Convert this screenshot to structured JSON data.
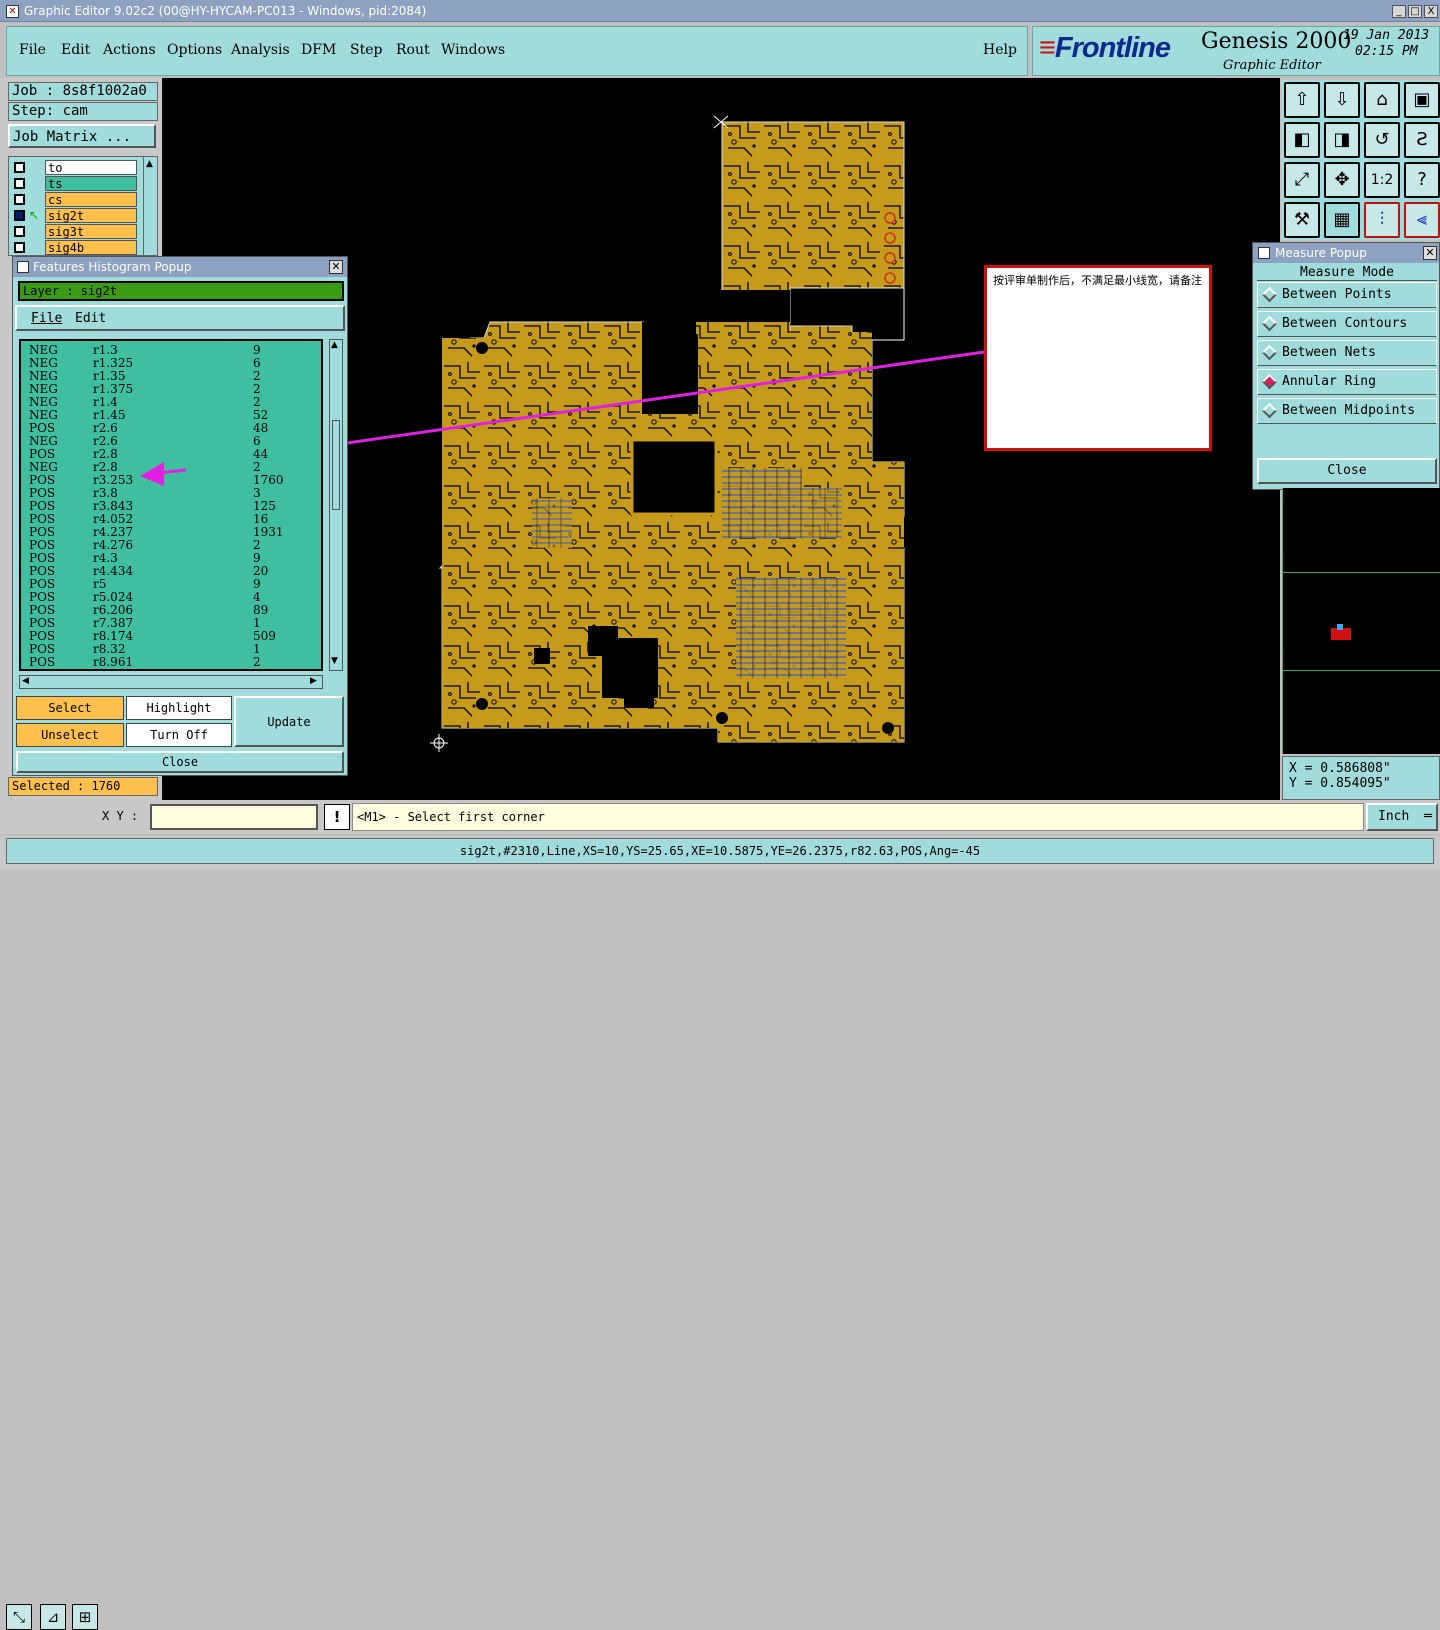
{
  "window": {
    "title": "Graphic Editor 9.02c2 (00@HY-HYCAM-PC013 - Windows, pid:2084)",
    "buttons": [
      "_",
      "□",
      "X"
    ]
  },
  "menubar": {
    "items": [
      "File",
      "Edit",
      "Actions",
      "Options",
      "Analysis",
      "DFM",
      "Step",
      "Rout",
      "Windows"
    ],
    "help": "Help"
  },
  "brand": {
    "logo": "Frontline",
    "product": "Genesis 2000",
    "subtitle": "Graphic Editor",
    "date": "19 Jan 2013",
    "time": "02:15 PM"
  },
  "job": {
    "job_label": "Job : 8s8f1002a0",
    "step_label": "Step: cam",
    "matrix_button": "Job Matrix ..."
  },
  "layers": [
    {
      "name": "to",
      "color": "#ffffff"
    },
    {
      "name": "ts",
      "color": "#3fbf9f"
    },
    {
      "name": "cs",
      "color": "#ffc04d"
    },
    {
      "name": "sig2t",
      "color": "#ffc04d"
    },
    {
      "name": "sig3t",
      "color": "#ffc04d"
    },
    {
      "name": "sig4b",
      "color": "#ffc04d"
    }
  ],
  "histogram_popup": {
    "title": "Features Histogram Popup",
    "layer_label": "Layer :  sig2t",
    "menu_file": "File",
    "menu_edit": "Edit",
    "rows": [
      [
        "NEG",
        "r1.3",
        "9"
      ],
      [
        "NEG",
        "r1.325",
        "6"
      ],
      [
        "NEG",
        "r1.35",
        "2"
      ],
      [
        "NEG",
        "r1.375",
        "2"
      ],
      [
        "NEG",
        "r1.4",
        "2"
      ],
      [
        "NEG",
        "r1.45",
        "52"
      ],
      [
        "POS",
        "r2.6",
        "48"
      ],
      [
        "NEG",
        "r2.6",
        "6"
      ],
      [
        "POS",
        "r2.8",
        "44"
      ],
      [
        "NEG",
        "r2.8",
        "2"
      ],
      [
        "POS",
        "r3.253",
        "1760"
      ],
      [
        "POS",
        "r3.8",
        "3"
      ],
      [
        "POS",
        "r3.843",
        "125"
      ],
      [
        "POS",
        "r4.052",
        "16"
      ],
      [
        "POS",
        "r4.237",
        "1931"
      ],
      [
        "POS",
        "r4.276",
        "2"
      ],
      [
        "POS",
        "r4.3",
        "9"
      ],
      [
        "POS",
        "r4.434",
        "20"
      ],
      [
        "POS",
        "r5",
        "9"
      ],
      [
        "POS",
        "r5.024",
        "4"
      ],
      [
        "POS",
        "r6.206",
        "89"
      ],
      [
        "POS",
        "r7.387",
        "1"
      ],
      [
        "POS",
        "r8.174",
        "509"
      ],
      [
        "POS",
        "r8.32",
        "1"
      ],
      [
        "POS",
        "r8.961",
        "2"
      ]
    ],
    "select": "Select",
    "highlight": "Highlight",
    "unselect": "Unselect",
    "turn_off": "Turn Off",
    "update": "Update",
    "close": "Close"
  },
  "selected_label": "Selected : 1760",
  "annotation": {
    "text": "按评审单制作后，不满足最小线宽，请备注"
  },
  "measure_popup": {
    "title": "Measure Popup",
    "mode_label": "Measure Mode",
    "options": [
      {
        "label": "Between Points",
        "selected": false
      },
      {
        "label": "Between Contours",
        "selected": false
      },
      {
        "label": "Between Nets",
        "selected": false
      },
      {
        "label": "Annular Ring",
        "selected": true
      },
      {
        "label": "Between Midpoints",
        "selected": false
      }
    ],
    "close": "Close"
  },
  "toolbox": {
    "icons": [
      "layer-up-icon",
      "layer-down-icon",
      "home-icon",
      "window-icon",
      "shift-left-icon",
      "shift-right-icon",
      "rotate-icon",
      "redraw-icon",
      "fit-icon",
      "zoom-in-icon",
      "one-to-one-icon",
      "help-icon",
      "tool-icon",
      "grid-icon",
      "snap-icon",
      "drc-icon"
    ],
    "one_to_one": "1:2",
    "help": "?"
  },
  "coords": {
    "x_label": "X = 0.586808\"",
    "y_label": "Y = 0.854095\""
  },
  "status": {
    "xy_label": "X Y :",
    "xy_value": "",
    "prompt": "<M1> - Select first corner",
    "units": "Inch",
    "bang": "!"
  },
  "command_line": "sig2t,#2310,Line,XS=10,YS=25.65,XE=10.5875,YE=26.2375,r82.63,POS,Ang=-45",
  "colors": {
    "panel": "#a1dcdc",
    "copper": "#c69a1a",
    "trace_blue": "#3a5fd0",
    "annotation_border": "#d01010",
    "arrow": "#e020e0",
    "selected_layer": "#ffc04d"
  }
}
